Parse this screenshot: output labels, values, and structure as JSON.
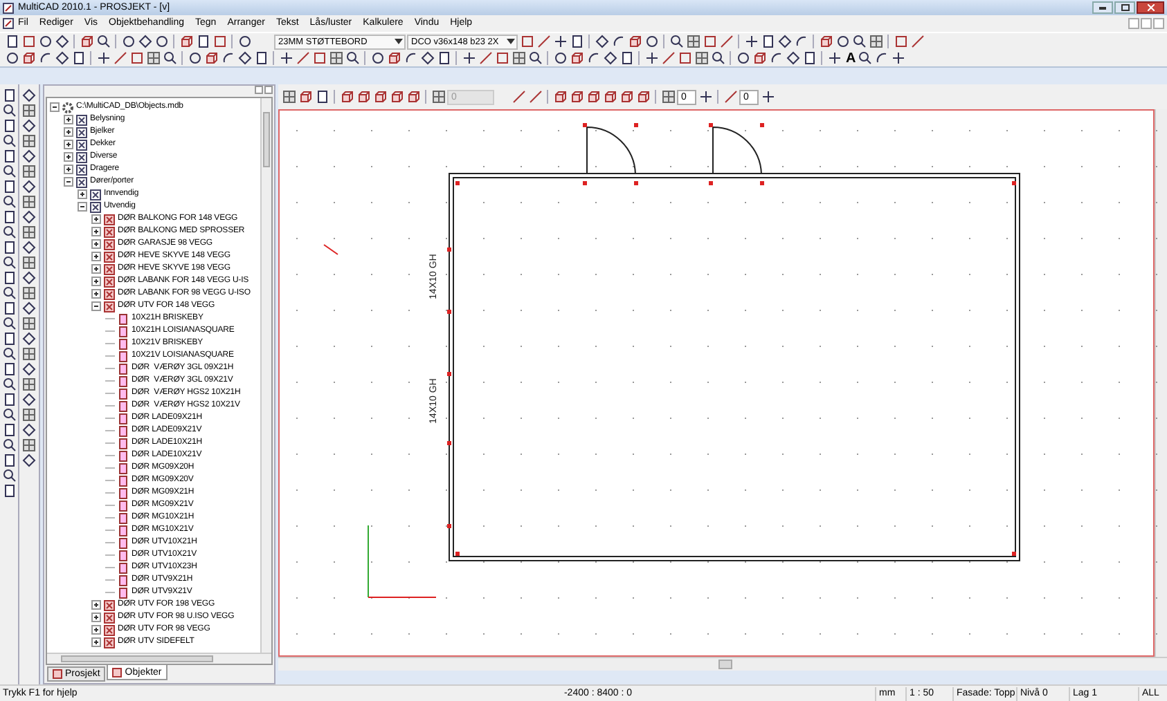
{
  "window": {
    "title": "MultiCAD 2010.1 - PROSJEKT - [v]"
  },
  "menu": [
    "Fil",
    "Rediger",
    "Vis",
    "Objektbehandling",
    "Tegn",
    "Arranger",
    "Tekst",
    "Lås/luster",
    "Kalkulere",
    "Vindu",
    "Hjelp"
  ],
  "toolbar": {
    "combos": [
      "23MM STØTTEBORD",
      "DCO v36x148 b23 2X"
    ]
  },
  "toolbar_2": {
    "text_tool": "A"
  },
  "tree": {
    "items": [
      {
        "label": "C:\\MultiCAD_DB\\Objects.mdb",
        "kind": "database",
        "expanded": true,
        "children": [
          {
            "label": "Belysning",
            "kind": "category",
            "expanded": false
          },
          {
            "label": "Bjelker",
            "kind": "category",
            "expanded": false
          },
          {
            "label": "Dekker",
            "kind": "category",
            "expanded": false
          },
          {
            "label": "Diverse",
            "kind": "category",
            "expanded": false
          },
          {
            "label": "Dragere",
            "kind": "category",
            "expanded": false
          },
          {
            "label": "Dører/porter",
            "kind": "category",
            "expanded": true,
            "children": [
              {
                "label": "Innvendig",
                "kind": "category",
                "expanded": false
              },
              {
                "label": "Utvendig",
                "kind": "category",
                "expanded": true,
                "children": [
                  {
                    "label": "DØR BALKONG FOR 148 VEGG",
                    "kind": "group",
                    "expanded": false
                  },
                  {
                    "label": "DØR BALKONG MED SPROSSER",
                    "kind": "group",
                    "expanded": false
                  },
                  {
                    "label": "DØR GARASJE 98 VEGG",
                    "kind": "group",
                    "expanded": false
                  },
                  {
                    "label": "DØR HEVE SKYVE 148 VEGG",
                    "kind": "group",
                    "expanded": false
                  },
                  {
                    "label": "DØR HEVE SKYVE 198 VEGG",
                    "kind": "group",
                    "expanded": false
                  },
                  {
                    "label": "DØR LABANK FOR 148 VEGG U-IS",
                    "kind": "group",
                    "expanded": false
                  },
                  {
                    "label": "DØR LABANK FOR 98 VEGG U-ISO",
                    "kind": "group",
                    "expanded": false
                  },
                  {
                    "label": "DØR UTV FOR 148 VEGG",
                    "kind": "group",
                    "expanded": true,
                    "children": [
                      {
                        "label": "10X21H BRISKEBY",
                        "kind": "object"
                      },
                      {
                        "label": "10X21H LOISIANASQUARE",
                        "kind": "object"
                      },
                      {
                        "label": "10X21V BRISKEBY",
                        "kind": "object"
                      },
                      {
                        "label": "10X21V LOISIANASQUARE",
                        "kind": "object"
                      },
                      {
                        "label": "DØR  VÆRØY 3GL 09X21H",
                        "kind": "object"
                      },
                      {
                        "label": "DØR  VÆRØY 3GL 09X21V",
                        "kind": "object"
                      },
                      {
                        "label": "DØR  VÆRØY HGS2 10X21H",
                        "kind": "object"
                      },
                      {
                        "label": "DØR  VÆRØY HGS2 10X21V",
                        "kind": "object"
                      },
                      {
                        "label": "DØR LADE09X21H",
                        "kind": "object"
                      },
                      {
                        "label": "DØR LADE09X21V",
                        "kind": "object"
                      },
                      {
                        "label": "DØR LADE10X21H",
                        "kind": "object"
                      },
                      {
                        "label": "DØR LADE10X21V",
                        "kind": "object"
                      },
                      {
                        "label": "DØR MG09X20H",
                        "kind": "object"
                      },
                      {
                        "label": "DØR MG09X20V",
                        "kind": "object"
                      },
                      {
                        "label": "DØR MG09X21H",
                        "kind": "object"
                      },
                      {
                        "label": "DØR MG09X21V",
                        "kind": "object"
                      },
                      {
                        "label": "DØR MG10X21H",
                        "kind": "object"
                      },
                      {
                        "label": "DØR MG10X21V",
                        "kind": "object"
                      },
                      {
                        "label": "DØR UTV10X21H",
                        "kind": "object"
                      },
                      {
                        "label": "DØR UTV10X21V",
                        "kind": "object"
                      },
                      {
                        "label": "DØR UTV10X23H",
                        "kind": "object"
                      },
                      {
                        "label": "DØR UTV9X21H",
                        "kind": "object"
                      },
                      {
                        "label": "DØR UTV9X21V",
                        "kind": "object"
                      }
                    ]
                  },
                  {
                    "label": "DØR UTV FOR 198 VEGG",
                    "kind": "group",
                    "expanded": false
                  },
                  {
                    "label": "DØR UTV FOR 98 U.ISO VEGG",
                    "kind": "group",
                    "expanded": false
                  },
                  {
                    "label": "DØR UTV FOR 98 VEGG",
                    "kind": "group",
                    "expanded": false
                  },
                  {
                    "label": "DØR UTV SIDEFELT",
                    "kind": "group",
                    "expanded": false
                  }
                ]
              }
            ]
          }
        ]
      }
    ]
  },
  "panel_tabs": [
    {
      "label": "Prosjekt",
      "selected": false
    },
    {
      "label": "Objekter",
      "selected": true
    }
  ],
  "drawing_toolbar": {
    "fields": [
      {
        "value": "0",
        "disabled": true
      },
      {
        "value": "0",
        "disabled": false
      },
      {
        "value": "0",
        "disabled": false
      }
    ]
  },
  "canvas": {
    "labels": [
      "14X10 GH",
      "14X10 GH"
    ]
  },
  "status_bar": {
    "hint": "Trykk F1 for hjelp",
    "coordinates": "-2400 : 8400 : 0",
    "unit": "mm",
    "scale": "1 : 50",
    "view": "Fasade: Topp",
    "level_name": "Nivå 0",
    "layer": "Lag 1",
    "filter": "ALL"
  }
}
